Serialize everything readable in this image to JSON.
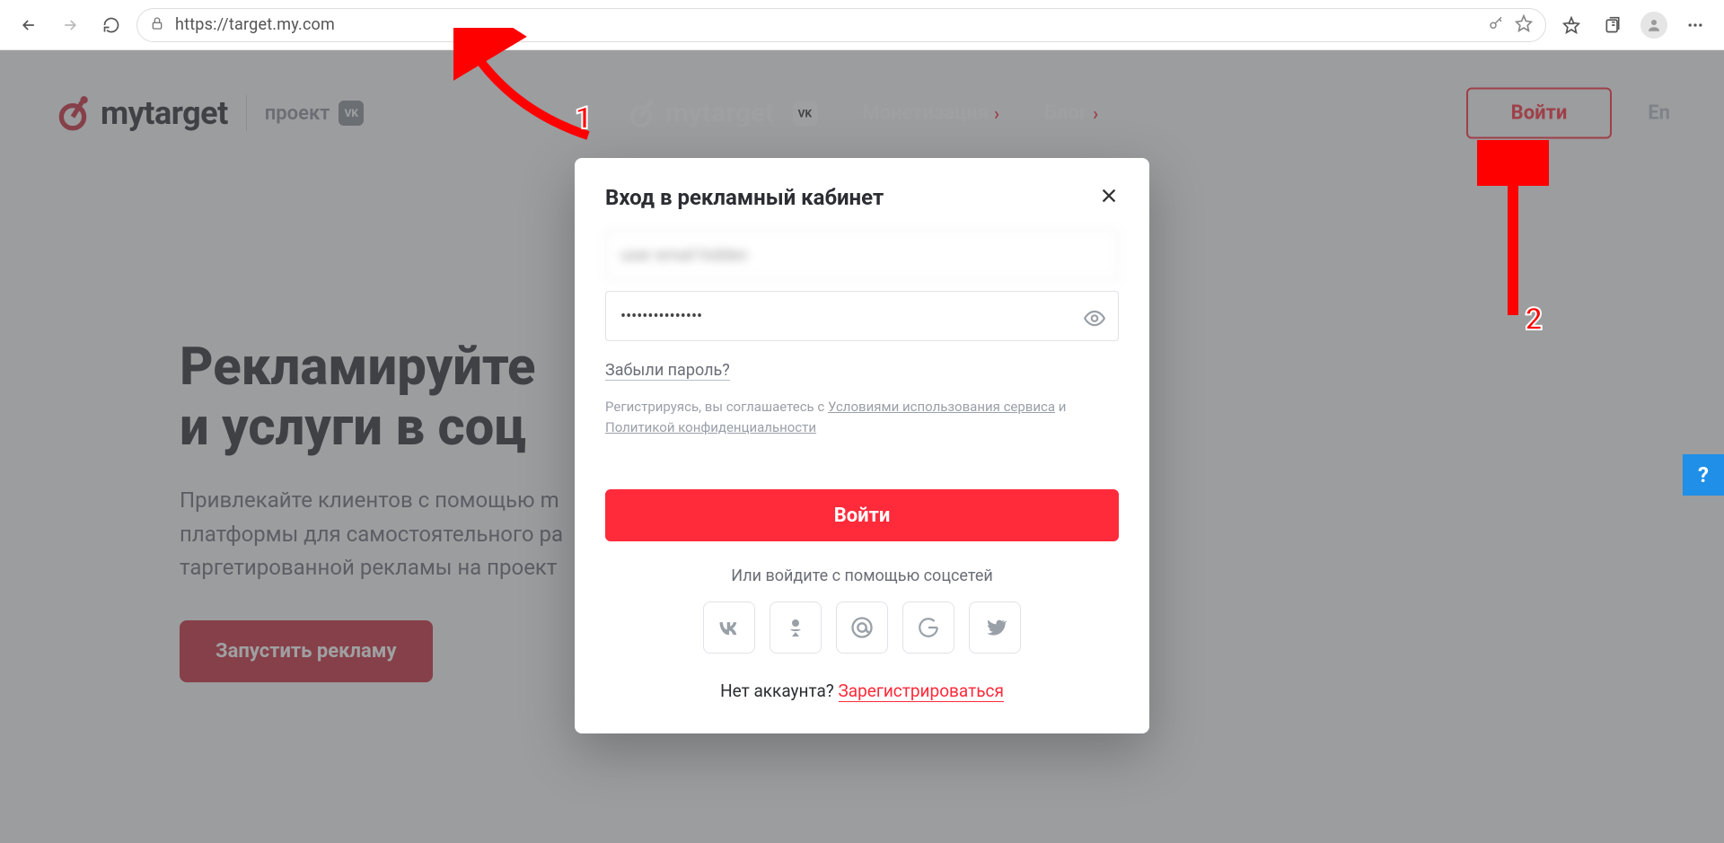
{
  "browser": {
    "url": "https://target.my.com"
  },
  "header": {
    "logo_text": "mytarget",
    "project_label": "проект",
    "center_logo_text": "mytarget",
    "nav": {
      "monetization": "Монетизация",
      "blog": "Блог"
    },
    "login_btn": "Войти",
    "lang": "En"
  },
  "hero": {
    "title_line1": "Рекламируйте",
    "title_line2": "и услуги в соц",
    "desc_line1": "Привлекайте клиентов с помощью m",
    "desc_line2": "платформы для самостоятельного ра",
    "desc_line3": "таргетированной рекламы на проект",
    "cta": "Запустить рекламу"
  },
  "modal": {
    "title": "Вход в рекламный кабинет",
    "email_value": "user email hidden",
    "password_dots": "•••••••••••••••",
    "forgot": "Забыли пароль?",
    "legal_prefix": "Регистрируясь, вы соглашаетесь с ",
    "legal_terms": "Условиями использования сервиса",
    "legal_and": " и ",
    "legal_privacy": "Политикой конфиденциальности",
    "submit": "Войти",
    "or_social": "Или войдите с помощью соцсетей",
    "no_account": "Нет аккаунта? ",
    "register": "Зарегистрироваться"
  },
  "annotations": {
    "num1": "1",
    "num2": "2"
  },
  "help": {
    "label": "?"
  }
}
